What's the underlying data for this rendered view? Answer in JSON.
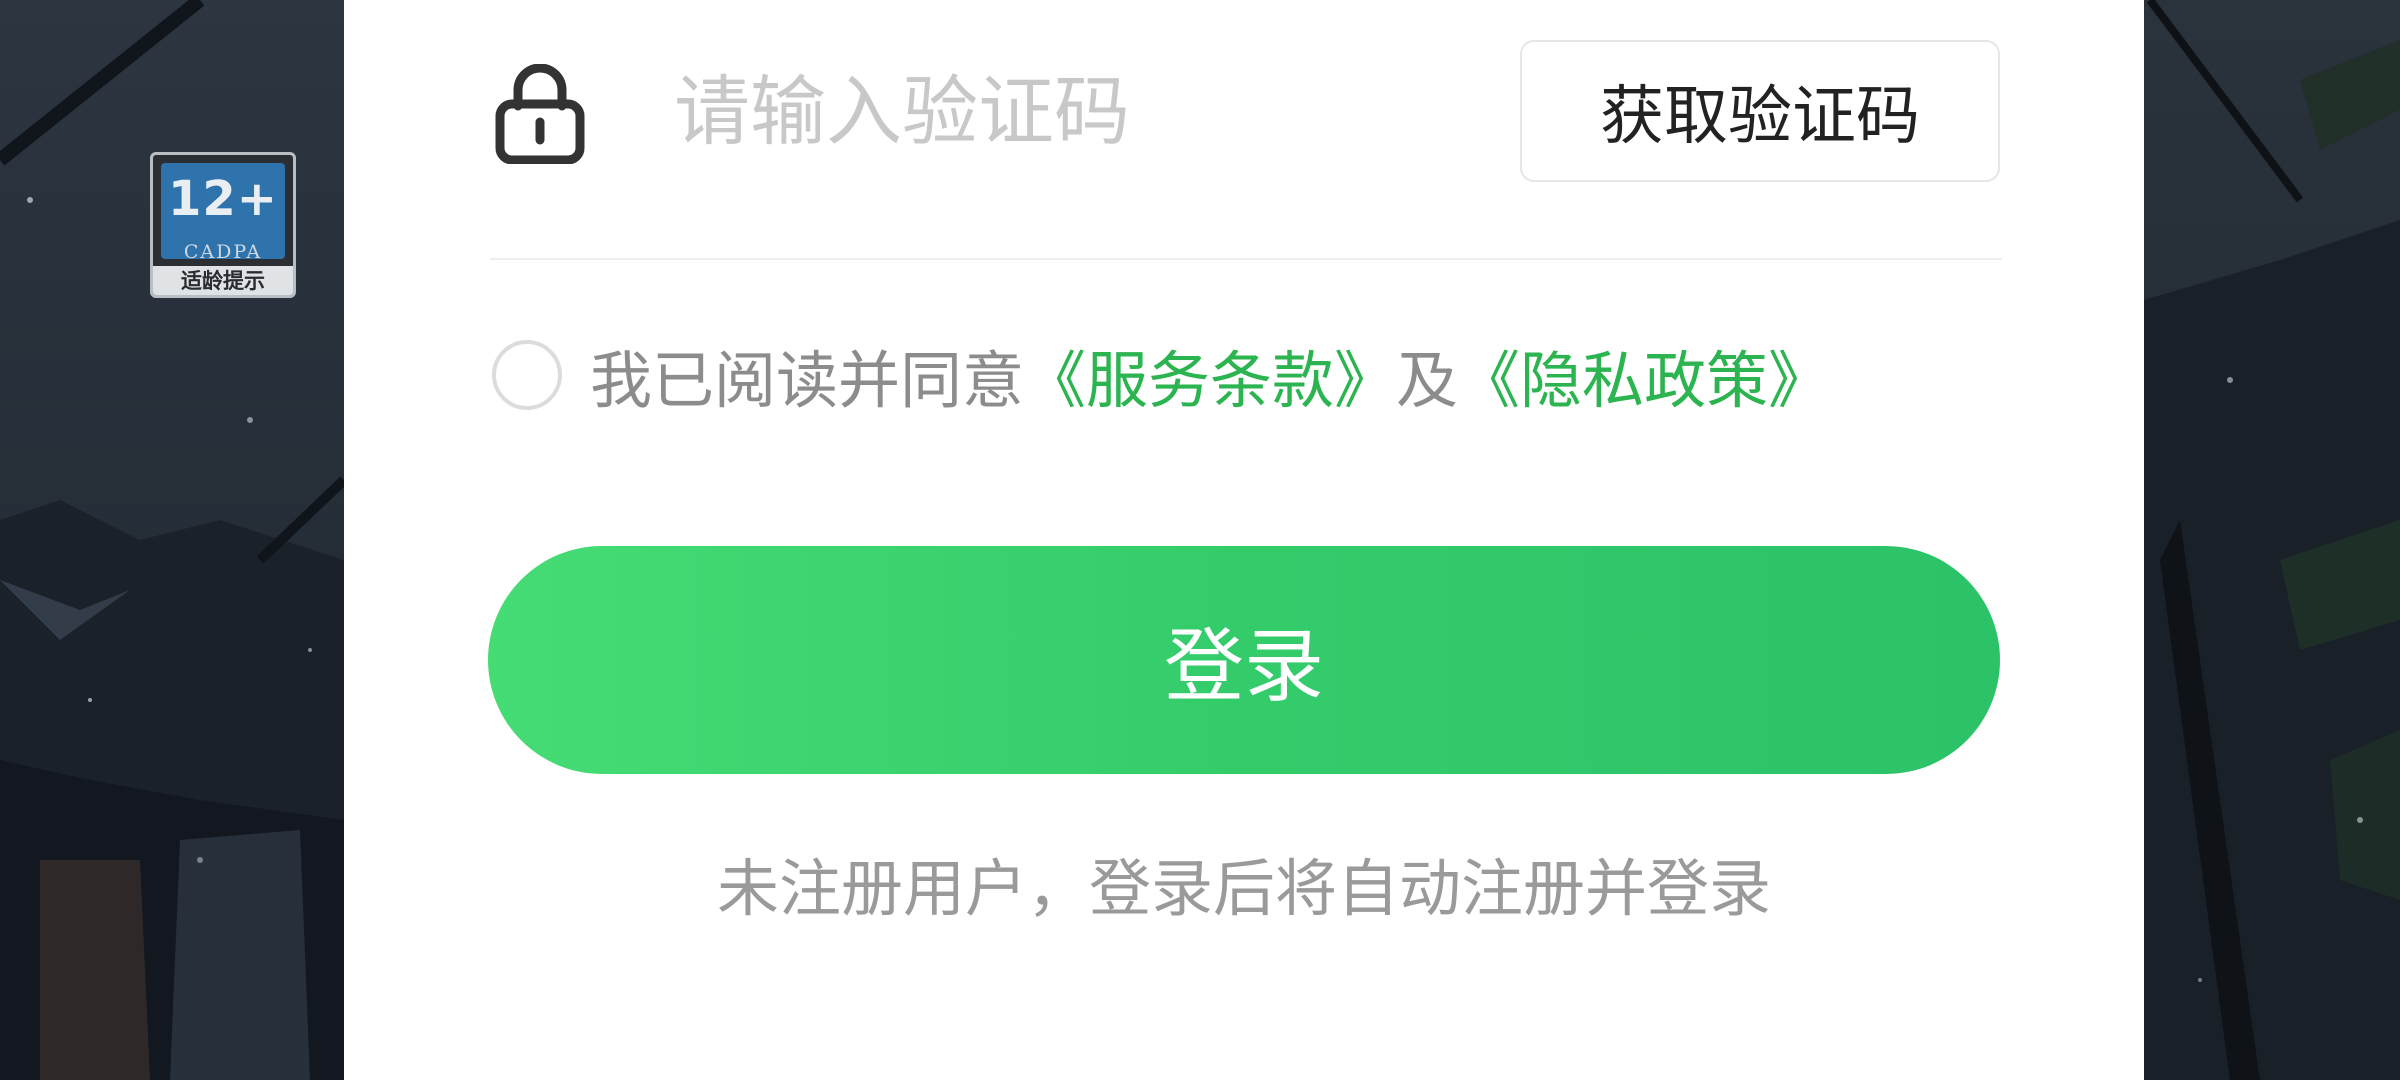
{
  "age_rating": {
    "age": "12+",
    "org": "CADPA",
    "tip": "适龄提示"
  },
  "login_form": {
    "code_input": {
      "value": "",
      "placeholder": "请输入验证码"
    },
    "get_code_label": "获取验证码",
    "agreement": {
      "checked": false,
      "prefix": "我已阅读并同意",
      "terms_link": "《服务条款》",
      "connector": "及",
      "privacy_link": "《隐私政策》"
    },
    "login_label": "登录",
    "register_hint": "未注册用户，登录后将自动注册并登录"
  },
  "colors": {
    "accent": "#2bb44f",
    "button_gradient_start": "#45dc74",
    "button_gradient_end": "#2cc268"
  },
  "icons": {
    "lock": "lock-icon",
    "radio": "radio-unchecked-icon"
  }
}
